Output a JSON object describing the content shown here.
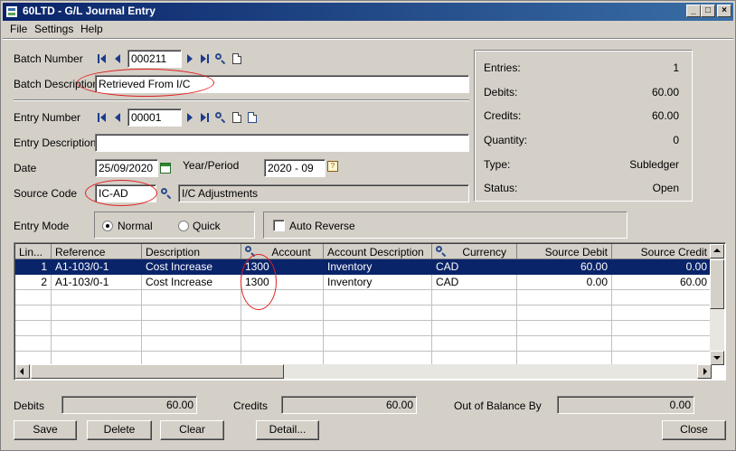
{
  "window": {
    "title": "60LTD - G/L Journal Entry",
    "minimize": "_",
    "maximize": "□",
    "close": "×"
  },
  "menu": {
    "file": "File",
    "settings": "Settings",
    "help": "Help"
  },
  "batch": {
    "number_label": "Batch Number",
    "number": "000211",
    "description_label": "Batch Description",
    "description": "Retrieved From I/C"
  },
  "entry": {
    "number_label": "Entry Number",
    "number": "00001",
    "description_label": "Entry Description",
    "description": "",
    "date_label": "Date",
    "date": "25/09/2020",
    "year_period_label": "Year/Period",
    "year_period": "2020 - 09",
    "source_code_label": "Source Code",
    "source_code": "IC-AD",
    "source_description": "I/C Adjustments",
    "mode_label": "Entry Mode",
    "mode_normal": "Normal",
    "mode_quick": "Quick",
    "auto_reverse": "Auto Reverse"
  },
  "summary": {
    "entries_label": "Entries:",
    "entries": "1",
    "debits_label": "Debits:",
    "debits": "60.00",
    "credits_label": "Credits:",
    "credits": "60.00",
    "quantity_label": "Quantity:",
    "quantity": "0",
    "type_label": "Type:",
    "type": "Subledger",
    "status_label": "Status:",
    "status": "Open"
  },
  "grid": {
    "columns": [
      "Lin...",
      "Reference",
      "Description",
      "Account",
      "Account Description",
      "Currency",
      "Source Debit",
      "Source Credit"
    ],
    "rows": [
      [
        "1",
        "A1-103/0-1",
        "Cost Increase",
        "1300",
        "Inventory",
        "CAD",
        "60.00",
        "0.00"
      ],
      [
        "2",
        "A1-103/0-1",
        "Cost Increase",
        "1300",
        "Inventory",
        "CAD",
        "0.00",
        "60.00"
      ]
    ]
  },
  "totals": {
    "debits_label": "Debits",
    "debits": "60.00",
    "credits_label": "Credits",
    "credits": "60.00",
    "oob_label": "Out of Balance By",
    "oob": "0.00"
  },
  "buttons": {
    "save": "Save",
    "delete": "Delete",
    "clear": "Clear",
    "detail": "Detail...",
    "close": "Close"
  },
  "colors": {
    "titlebar": "#0a246a",
    "selection": "#0a246a",
    "annotation": "#e02020"
  }
}
